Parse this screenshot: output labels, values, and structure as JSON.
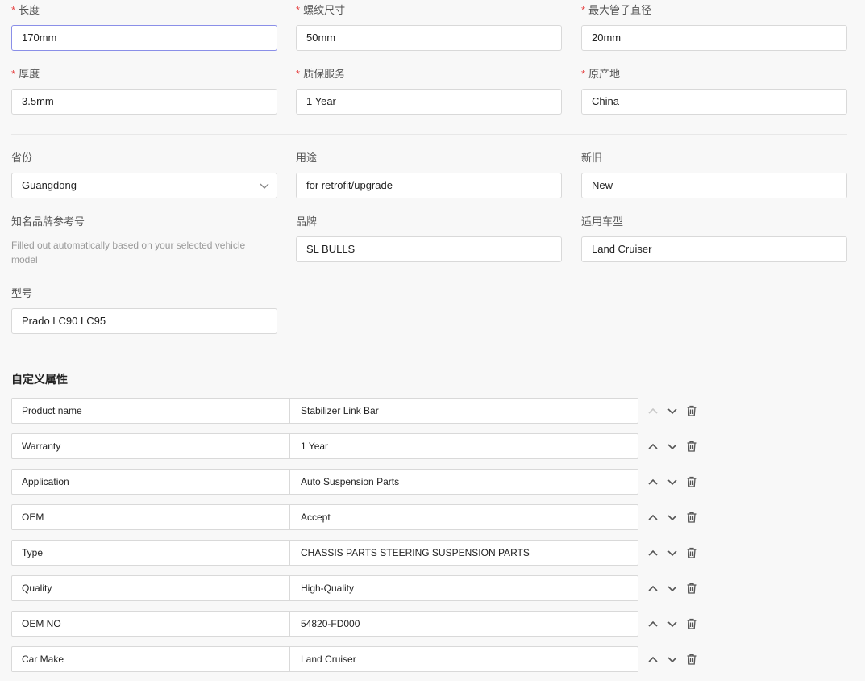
{
  "required_fields": [
    {
      "label": "长度",
      "value": "170mm"
    },
    {
      "label": "螺纹尺寸",
      "value": "50mm"
    },
    {
      "label": "最大管子直径",
      "value": "20mm"
    },
    {
      "label": "厚度",
      "value": "3.5mm"
    },
    {
      "label": "质保服务",
      "value": "1 Year"
    },
    {
      "label": "原产地",
      "value": "China"
    }
  ],
  "required_marker": "*",
  "optional_fields": {
    "province": {
      "label": "省份",
      "value": "Guangdong"
    },
    "usage": {
      "label": "用途",
      "value": "for retrofit/upgrade"
    },
    "condition": {
      "label": "新旧",
      "value": "New"
    },
    "brand_ref": {
      "label": "知名品牌参考号",
      "hint": "Filled out automatically based on your selected vehicle model"
    },
    "brand": {
      "label": "品牌",
      "value": "SL BULLS"
    },
    "vehicle": {
      "label": "适用车型",
      "value": "Land Cruiser"
    },
    "model": {
      "label": "型号",
      "value": "Prado LC90 LC95"
    }
  },
  "custom_attributes": {
    "title": "自定义属性",
    "rows": [
      {
        "key": "Product name",
        "value": "Stabilizer Link Bar",
        "up_disabled": true
      },
      {
        "key": "Warranty",
        "value": "1 Year",
        "up_disabled": false
      },
      {
        "key": "Application",
        "value": "Auto Suspension Parts",
        "up_disabled": false
      },
      {
        "key": "OEM",
        "value": "Accept",
        "up_disabled": false
      },
      {
        "key": "Type",
        "value": "CHASSIS PARTS STEERING SUSPENSION PARTS",
        "up_disabled": false
      },
      {
        "key": "Quality",
        "value": "High-Quality",
        "up_disabled": false
      },
      {
        "key": "OEM NO",
        "value": "54820-FD000",
        "up_disabled": false
      },
      {
        "key": "Car Make",
        "value": "Land Cruiser",
        "up_disabled": false
      }
    ]
  },
  "icons": {
    "move_up": "chevron-up-icon",
    "move_down": "chevron-down-icon",
    "delete": "trash-icon",
    "select": "chevron-down-icon"
  },
  "colors": {
    "required": "#e64545",
    "focus_border": "#8a8fe8",
    "icon": "#555555",
    "icon_disabled": "#c8c8c8"
  }
}
